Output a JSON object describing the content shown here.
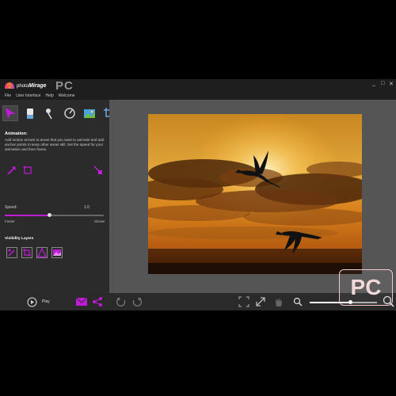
{
  "app": {
    "name_prefix": "photo",
    "name_main": "Mirage",
    "watermark_top": "PC",
    "watermark_bottom": "PC",
    "window_controls": {
      "minimize": "_",
      "maximize": "□",
      "close": "✕"
    }
  },
  "menu": [
    "File",
    "User Interface",
    "Help",
    "Welcome"
  ],
  "tools": [
    {
      "icon": "motion-arrow-tool-icon",
      "active": true
    },
    {
      "icon": "eraser-tool-icon",
      "active": false
    },
    {
      "icon": "anchor-point-tool-icon",
      "active": false
    },
    {
      "icon": "stabilize-tool-icon",
      "active": false
    },
    {
      "icon": "overlay-image-tool-icon",
      "active": false
    },
    {
      "icon": "crop-tool-icon",
      "active": false
    }
  ],
  "animation": {
    "title": "Animation:",
    "description": "Add motion arrows to areas that you want to animate and add anchor points to keep other areas still. Set the speed for your animation and then frame.",
    "speed_label": "Speed:",
    "speed_value": "1.0",
    "speed_fraction": 0.45,
    "faster_label": "Faster",
    "slower_label": "Slower"
  },
  "visibility": {
    "title": "Visibility Layers",
    "layers": [
      "motion-layer-icon",
      "crop-layer-icon",
      "mask-layer-icon",
      "image-layer-icon"
    ]
  },
  "bottom": {
    "play_label": "Play",
    "zoom_fraction": 0.6
  },
  "colors": {
    "accent": "#c21ad9",
    "panel": "#2b2b2b",
    "canvas": "#555555"
  }
}
